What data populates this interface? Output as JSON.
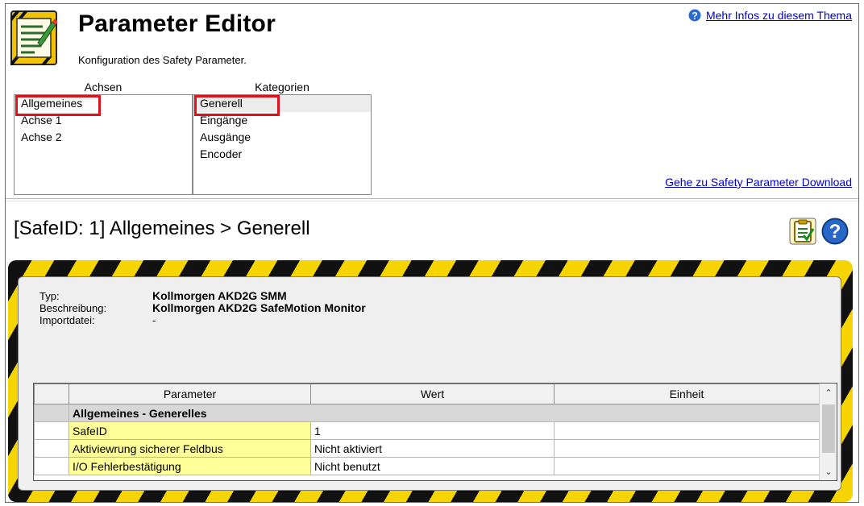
{
  "header": {
    "title": "Parameter Editor",
    "subtitle": "Konfiguration des Safety Parameter.",
    "help_link": "Mehr Infos zu diesem Thema",
    "goto_link": "Gehe zu Safety Parameter Download",
    "app_icon": "parameter-editor-icon",
    "help_icon": "question-circle-icon"
  },
  "axes": {
    "heading": "Achsen",
    "items": [
      "Allgemeines",
      "Achse 1",
      "Achse 2"
    ],
    "selected": "Allgemeines"
  },
  "categories": {
    "heading": "Kategorien",
    "items": [
      "Generell",
      "Eingänge",
      "Ausgänge",
      "Encoder"
    ],
    "selected": "Generell"
  },
  "section": {
    "title": "[SafeID: 1]  Allgemeines > Generell",
    "tool_icons": [
      "checklist-clipboard-icon",
      "help-icon"
    ]
  },
  "info": {
    "type_label": "Typ:",
    "type_value": "Kollmorgen AKD2G SMM",
    "desc_label": "Beschreibung:",
    "desc_value": "Kollmorgen AKD2G SafeMotion Monitor",
    "import_label": "Importdatei:",
    "import_value": "-"
  },
  "table": {
    "columns": [
      "Parameter",
      "Wert",
      "Einheit"
    ],
    "group": "Allgemeines - Generelles",
    "rows": [
      {
        "parameter": "SafeID",
        "value": "1",
        "unit": ""
      },
      {
        "parameter": "Aktiviewrung sicherer Feldbus",
        "value": "Nicht aktiviert",
        "unit": ""
      },
      {
        "parameter": "I/O Fehlerbestätigung",
        "value": "Nicht benutzt",
        "unit": ""
      }
    ]
  },
  "colors": {
    "link": "#0000cc",
    "highlight_box": "#e0101a",
    "hazard_yellow": "#f5d400",
    "param_cell": "#ffff99"
  }
}
